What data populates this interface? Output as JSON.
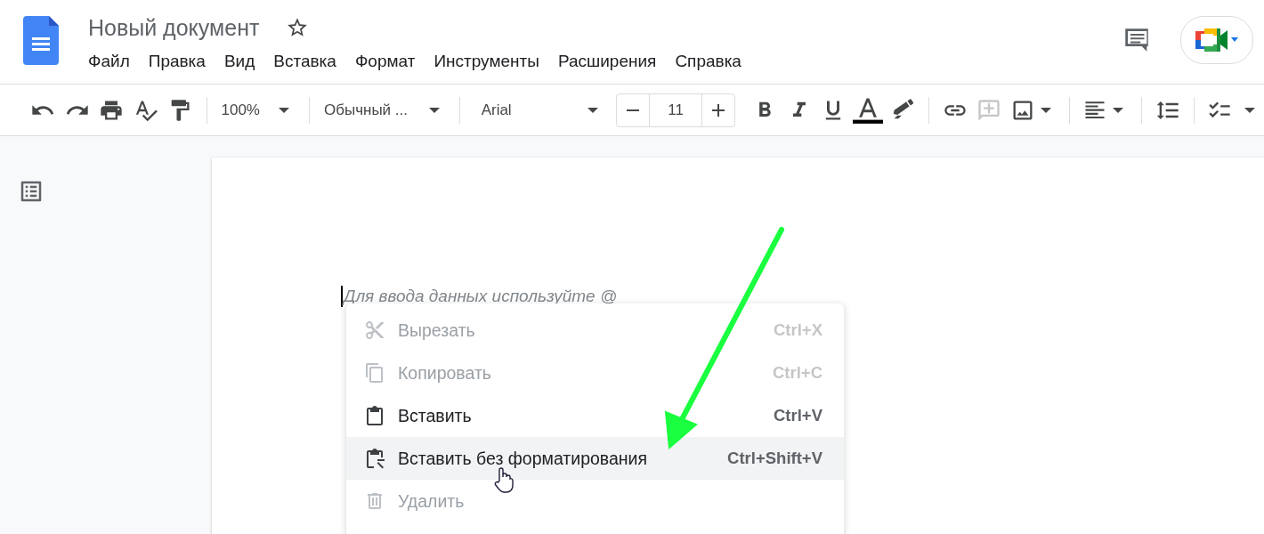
{
  "document": {
    "title": "Новый документ",
    "starred": false
  },
  "menu_bar": [
    "Файл",
    "Правка",
    "Вид",
    "Вставка",
    "Формат",
    "Инструменты",
    "Расширения",
    "Справка"
  ],
  "toolbar": {
    "zoom": "100%",
    "style": "Обычный ...",
    "font": "Arial",
    "font_size": "11",
    "insert_comment_disabled": true
  },
  "page": {
    "placeholder": "Для ввода данных используйте @"
  },
  "context_menu": [
    {
      "kind": "cut",
      "label": "Вырезать",
      "shortcut": "Ctrl+X",
      "disabled": true,
      "selected": false
    },
    {
      "kind": "copy",
      "label": "Копировать",
      "shortcut": "Ctrl+C",
      "disabled": true,
      "selected": false
    },
    {
      "kind": "paste",
      "label": "Вставить",
      "shortcut": "Ctrl+V",
      "disabled": false,
      "selected": false
    },
    {
      "kind": "paste_plain",
      "label": "Вставить без форматирования",
      "shortcut": "Ctrl+Shift+V",
      "disabled": false,
      "selected": true
    },
    {
      "kind": "delete",
      "label": "Удалить",
      "disabled": true,
      "selected": false
    }
  ]
}
